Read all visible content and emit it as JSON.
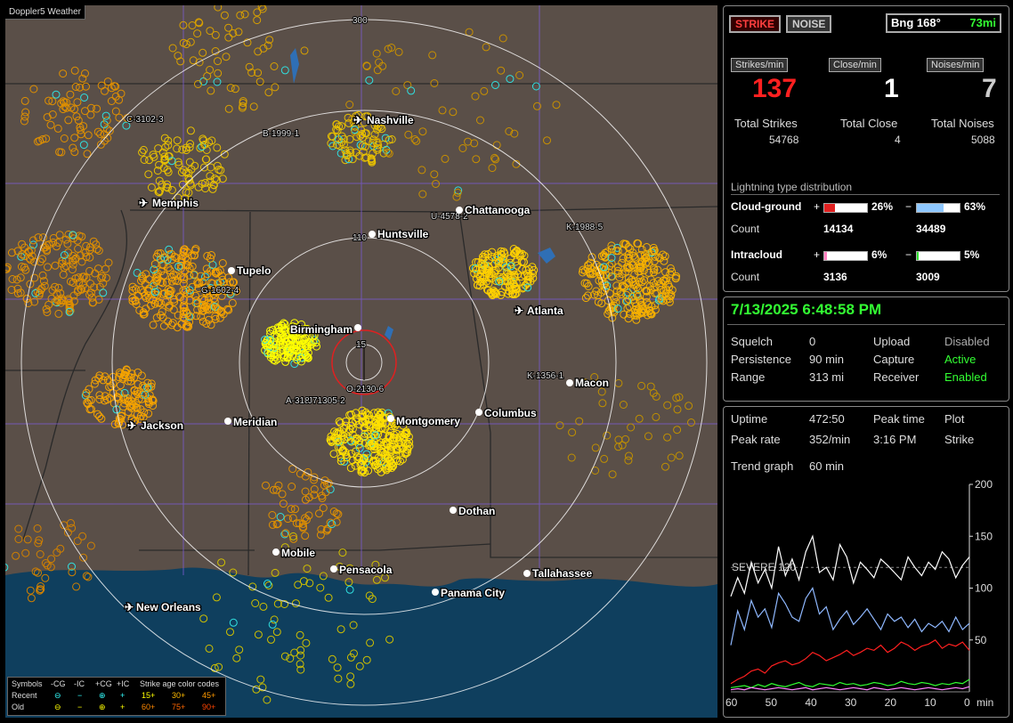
{
  "app": {
    "title": "Doppler5 Weather"
  },
  "map": {
    "cities": [
      {
        "name": "Nashville",
        "airport": true
      },
      {
        "name": "Memphis",
        "airport": true
      },
      {
        "name": "Chattanooga",
        "airport": false
      },
      {
        "name": "Huntsville",
        "airport": false
      },
      {
        "name": "Tupelo",
        "airport": false
      },
      {
        "name": "Birmingham",
        "airport": false
      },
      {
        "name": "Atlanta",
        "airport": true
      },
      {
        "name": "Macon",
        "airport": false
      },
      {
        "name": "Jackson",
        "airport": true
      },
      {
        "name": "Meridian",
        "airport": false
      },
      {
        "name": "Montgomery",
        "airport": false
      },
      {
        "name": "Columbus",
        "airport": false
      },
      {
        "name": "Dothan",
        "airport": false
      },
      {
        "name": "Mobile",
        "airport": false
      },
      {
        "name": "Pensacola",
        "airport": false
      },
      {
        "name": "Panama City",
        "airport": false
      },
      {
        "name": "Tallahassee",
        "airport": false
      },
      {
        "name": "New Orleans",
        "airport": true
      }
    ],
    "ring_labels": [
      "300",
      "110",
      "15"
    ],
    "storm_labels": [
      "C-3102-3",
      "B-1999-1",
      "U-4578-2",
      "K-1988-5",
      "G-1602-4",
      "K-1356-1",
      "A-318",
      "J71305-2",
      "O-2130-6"
    ]
  },
  "legend": {
    "header": [
      "Symbols",
      "-CG",
      "-IC",
      "+CG",
      "+IC",
      "Strike age color codes"
    ],
    "recent": {
      "label": "Recent",
      "ages": [
        "15+",
        "30+",
        "45+"
      ]
    },
    "old": {
      "label": "Old",
      "ages": [
        "60+",
        "75+",
        "90+"
      ]
    }
  },
  "stats": {
    "strike_button": "STRIKE",
    "noise_button": "NOISE",
    "bearing": "Bng 168°",
    "distance": "73mi",
    "strikes_min_label": "Strikes/min",
    "close_min_label": "Close/min",
    "noises_min_label": "Noises/min",
    "strikes_min": "137",
    "close_min": "1",
    "noises_min": "7",
    "total_strikes_label": "Total Strikes",
    "total_close_label": "Total Close",
    "total_noises_label": "Total Noises",
    "total_strikes": "54768",
    "total_close": "4",
    "total_noises": "5088",
    "dist_title": "Lightning type distribution",
    "cg_label": "Cloud-ground",
    "ic_label": "Intracloud",
    "count_label": "Count",
    "plus": "+",
    "minus": "−",
    "cg_plus_pct": "26%",
    "cg_minus_pct": "63%",
    "cg_plus_count": "14134",
    "cg_minus_count": "34489",
    "ic_plus_pct": "6%",
    "ic_minus_pct": "5%",
    "ic_plus_count": "3136",
    "ic_minus_count": "3009",
    "cg_plus_frac": 0.26,
    "cg_minus_frac": 0.63,
    "ic_plus_frac": 0.06,
    "ic_minus_frac": 0.05
  },
  "status": {
    "datetime": "7/13/2025 6:48:58 PM",
    "squelch_label": "Squelch",
    "squelch": "0",
    "persistence_label": "Persistence",
    "persistence": "90 min",
    "range_label": "Range",
    "range": "313 mi",
    "upload_label": "Upload",
    "upload": "Disabled",
    "capture_label": "Capture",
    "capture": "Active",
    "receiver_label": "Receiver",
    "receiver": "Enabled"
  },
  "trend": {
    "uptime_label": "Uptime",
    "uptime": "472:50",
    "peak_time_label": "Peak time",
    "peak_time": "3:16 PM",
    "plot_label": "Plot",
    "plot": "Strike",
    "peak_rate_label": "Peak rate",
    "peak_rate": "352/min",
    "trend_graph_label": "Trend graph",
    "trend_graph": "60 min",
    "severe_label": "SEVERE 120"
  },
  "chart_data": {
    "type": "line",
    "x_ticks": [
      "60",
      "50",
      "40",
      "30",
      "20",
      "10",
      "0"
    ],
    "x_unit": "min",
    "y_ticks": [
      "200",
      "150",
      "100",
      "50"
    ],
    "ylim": [
      0,
      200
    ],
    "severe_threshold": 120,
    "series": [
      {
        "color": "#ffffff",
        "values": [
          92,
          110,
          95,
          125,
          105,
          118,
          100,
          140,
          112,
          128,
          108,
          135,
          150,
          115,
          120,
          108,
          142,
          130,
          105,
          125,
          118,
          110,
          128,
          122,
          115,
          108,
          130,
          120,
          112,
          125,
          118,
          135,
          128,
          110,
          122,
          130
        ]
      },
      {
        "color": "#8fb8ff",
        "values": [
          45,
          78,
          60,
          88,
          72,
          80,
          62,
          95,
          85,
          72,
          68,
          90,
          100,
          75,
          82,
          60,
          70,
          78,
          65,
          72,
          80,
          70,
          60,
          75,
          68,
          72,
          62,
          70,
          58,
          66,
          62,
          68,
          58,
          72,
          60,
          66
        ]
      },
      {
        "color": "#ff2020",
        "values": [
          8,
          12,
          15,
          20,
          22,
          18,
          25,
          28,
          30,
          26,
          28,
          32,
          38,
          35,
          30,
          33,
          36,
          40,
          35,
          38,
          42,
          40,
          45,
          38,
          42,
          48,
          45,
          40,
          44,
          46,
          50,
          42,
          46,
          44,
          48,
          40
        ]
      },
      {
        "color": "#30ff30",
        "values": [
          4,
          5,
          6,
          4,
          7,
          5,
          8,
          6,
          5,
          7,
          9,
          6,
          5,
          8,
          7,
          6,
          9,
          7,
          8,
          6,
          7,
          9,
          8,
          6,
          7,
          10,
          8,
          7,
          9,
          8,
          6,
          8,
          7,
          9,
          8,
          12
        ]
      },
      {
        "color": "#ff80ff",
        "values": [
          2,
          3,
          2,
          4,
          3,
          2,
          3,
          4,
          3,
          2,
          3,
          4,
          2,
          3,
          4,
          3,
          2,
          3,
          4,
          3,
          2,
          4,
          3,
          2,
          3,
          4,
          3,
          2,
          3,
          4,
          3,
          2,
          3,
          4,
          3,
          5
        ]
      }
    ]
  }
}
